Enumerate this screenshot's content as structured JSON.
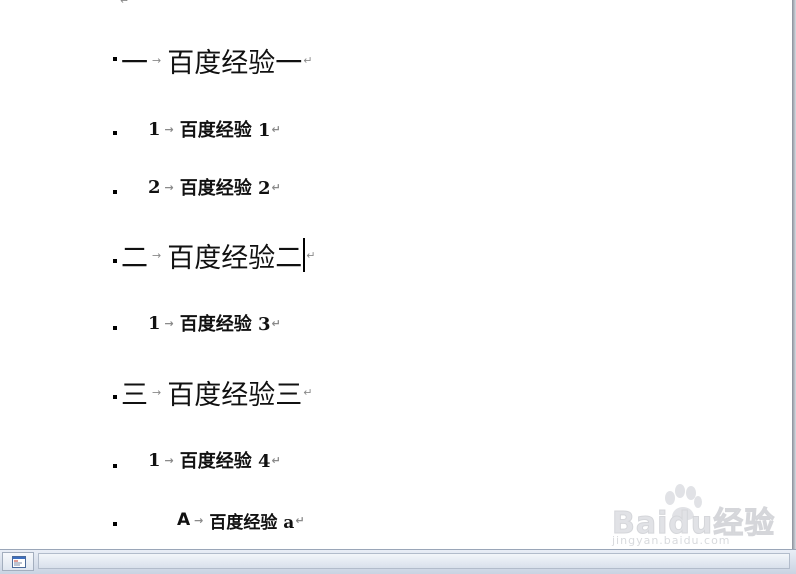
{
  "document": {
    "paragraph_mark": "↵",
    "tab_mark": "→",
    "paragraphs": [
      {
        "level": 1,
        "number": "一",
        "text": "百度经验一"
      },
      {
        "level": 2,
        "number": "1",
        "text": "百度经验 1"
      },
      {
        "level": 2,
        "number": "2",
        "text": "百度经验 2"
      },
      {
        "level": 1,
        "number": "二",
        "text": "百度经验二"
      },
      {
        "level": 2,
        "number": "1",
        "text": "百度经验 3"
      },
      {
        "level": 1,
        "number": "三",
        "text": "百度经验三"
      },
      {
        "level": 2,
        "number": "1",
        "text": "百度经验 4"
      },
      {
        "level": 3,
        "number": "A",
        "text": "百度经验 a"
      }
    ]
  },
  "watermark": {
    "brand": "Baidu经验",
    "url": "jingyan.baidu.com"
  },
  "statusbar": {
    "view_icon": "page-view-icon"
  }
}
